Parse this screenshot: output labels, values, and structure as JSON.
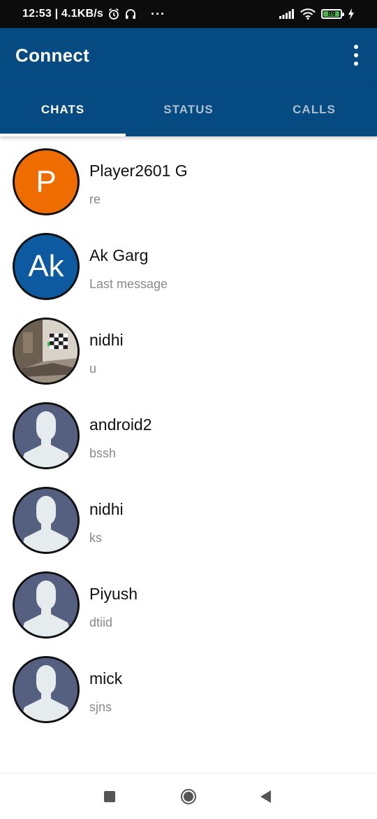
{
  "status_bar": {
    "time_info": "12:53 | 4.1KB/s",
    "dots": "···",
    "battery": "89",
    "battery_color": "#4caf50",
    "icons": [
      "alarm-icon",
      "headset-icon",
      "signal-icon",
      "wifi-icon",
      "battery-icon",
      "charging-icon"
    ]
  },
  "app_bar": {
    "title": "Connect",
    "menu_icon": "more-vertical-icon",
    "color": "#064a82"
  },
  "tabs": [
    {
      "label": "CHATS",
      "active": true
    },
    {
      "label": "STATUS",
      "active": false
    },
    {
      "label": "CALLS",
      "active": false
    }
  ],
  "chats": [
    {
      "name": "Player2601 G",
      "message": "re",
      "avatar": {
        "type": "letter",
        "letter": "P",
        "color": "#ef6c00"
      }
    },
    {
      "name": "Ak Garg",
      "message": "Last message",
      "avatar": {
        "type": "letter",
        "letter": "Ak",
        "color": "#0d5aa0"
      }
    },
    {
      "name": "nidhi",
      "message": "u",
      "avatar": {
        "type": "photo"
      }
    },
    {
      "name": "android2",
      "message": "bssh",
      "avatar": {
        "type": "default"
      }
    },
    {
      "name": "nidhi",
      "message": "ks",
      "avatar": {
        "type": "default"
      }
    },
    {
      "name": "Piyush",
      "message": "dtiid",
      "avatar": {
        "type": "default"
      }
    },
    {
      "name": "mick",
      "message": "sjns",
      "avatar": {
        "type": "default"
      }
    }
  ],
  "nav_bar": {
    "icons": [
      "recents-icon",
      "home-icon",
      "back-icon"
    ]
  }
}
